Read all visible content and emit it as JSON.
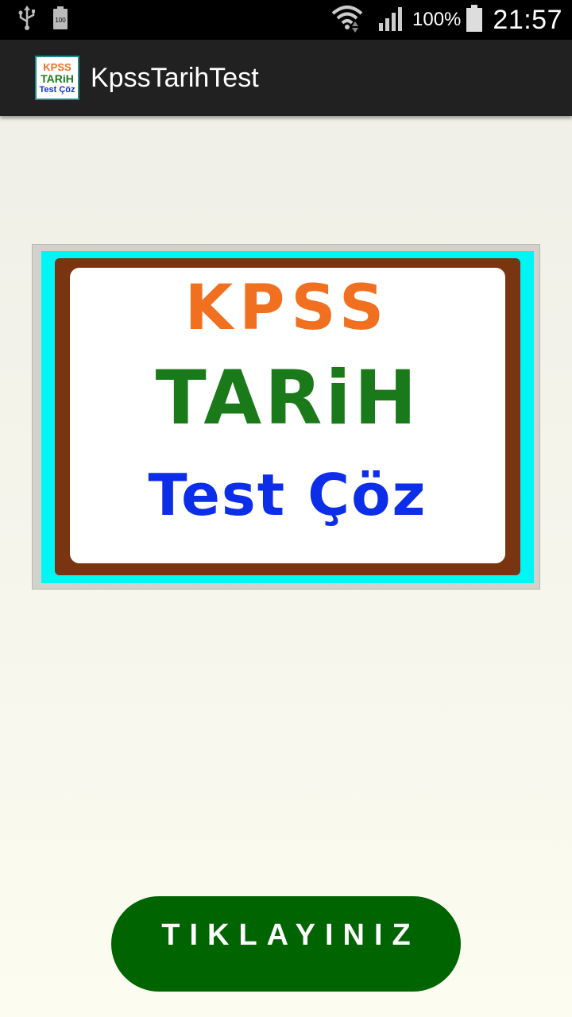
{
  "status_bar": {
    "icons_left": [
      "usb-icon",
      "battery-saver-icon"
    ],
    "icons_right": [
      "wifi-icon",
      "signal-icon",
      "battery-icon"
    ],
    "battery_percent": "100%",
    "battery_saver_label": "100",
    "time": "21:57"
  },
  "action_bar": {
    "app_icon": {
      "line1": "KPSS",
      "line2": "TARiH",
      "line3": "Test Çöz"
    },
    "title": "KpssTarihTest"
  },
  "logo": {
    "line1": "KPSS",
    "line2": "TARiH",
    "line3": "Test Çöz",
    "colors": {
      "line1": "#f07020",
      "line2": "#1a7a1a",
      "line3": "#0c2ee8",
      "frame_outer": "#00f5f5",
      "frame_inner": "#7a3510"
    }
  },
  "button": {
    "label": "TIKLAYINIZ",
    "color": "#006400"
  }
}
